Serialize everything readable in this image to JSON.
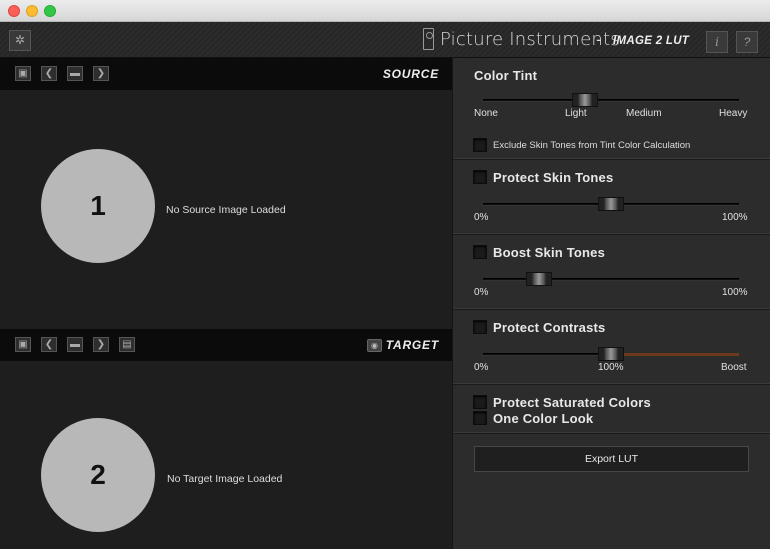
{
  "window": {
    "controls": [
      "close",
      "minimize",
      "maximize"
    ]
  },
  "header": {
    "settings_icon": "gear-icon",
    "brand_name": "Picture Instruments",
    "brand_separator": "-",
    "product": "IMAGE 2 LUT",
    "info_label": "i",
    "help_label": "?"
  },
  "source": {
    "label": "SOURCE",
    "toolbar_icons": [
      "load-icon",
      "prev-icon",
      "folder-icon",
      "next-icon"
    ],
    "badge": "1",
    "empty_message": "No Source Image Loaded"
  },
  "target": {
    "label": "TARGET",
    "toolbar_icons": [
      "load-icon",
      "prev-icon",
      "folder-icon",
      "next-icon",
      "save-icon"
    ],
    "eye_icon": "eye-icon",
    "badge": "2",
    "empty_message": "No Target Image Loaded"
  },
  "panel": {
    "color_tint": {
      "title": "Color Tint",
      "ticks": [
        "None",
        "Light",
        "Medium",
        "Heavy"
      ],
      "value": 0.4,
      "exclude_label": "Exclude Skin Tones from Tint Color Calculation",
      "exclude_checked": false
    },
    "protect_skin": {
      "title": "Protect Skin Tones",
      "checked": false,
      "min_label": "0%",
      "max_label": "100%",
      "value": 0.5
    },
    "boost_skin": {
      "title": "Boost Skin Tones",
      "checked": false,
      "min_label": "0%",
      "max_label": "100%",
      "value": 0.22
    },
    "protect_contrasts": {
      "title": "Protect Contrasts",
      "checked": false,
      "min_label": "0%",
      "mid_label": "100%",
      "max_label": "Boost",
      "value": 0.5
    },
    "protect_saturated": {
      "title": "Protect Saturated Colors",
      "checked": false
    },
    "one_color_look": {
      "title": "One Color Look",
      "checked": false
    },
    "export_label": "Export LUT",
    "accent_color": "#6a3a1a"
  }
}
